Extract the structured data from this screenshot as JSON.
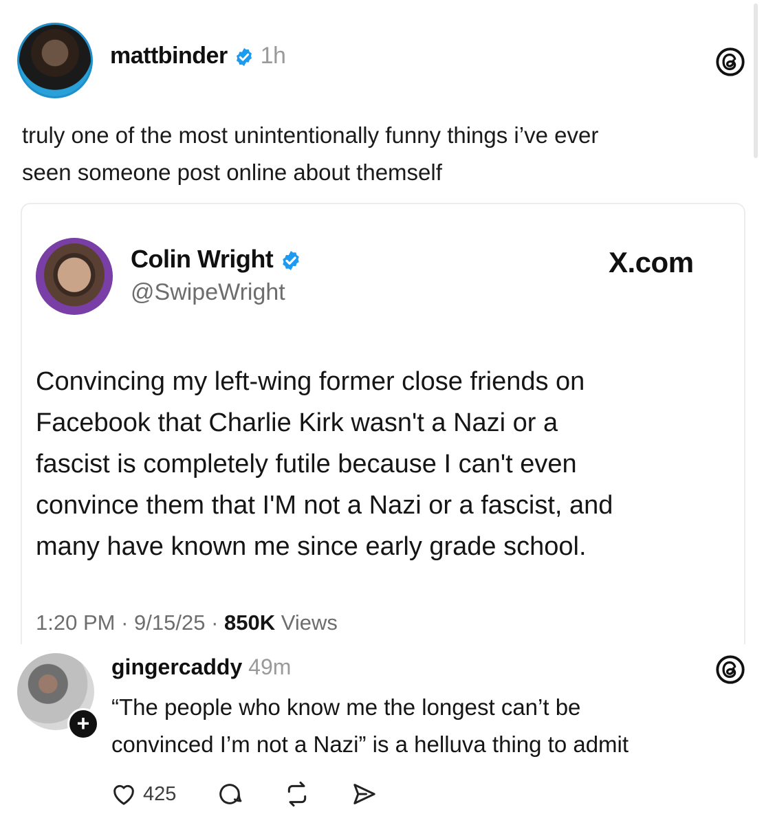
{
  "post": {
    "username": "mattbinder",
    "time": "1h",
    "text_line1": "truly one of the most unintentionally funny things i’ve ever",
    "text_line2": "seen someone post online about themself"
  },
  "quote": {
    "name": "Colin Wright",
    "handle": "@SwipeWright",
    "source": "X.com",
    "body_lines": [
      "Convincing my left-wing former close friends on",
      "Facebook that Charlie Kirk wasn't a Nazi or a",
      "fascist is completely futile because I can't even",
      "convince them that I'M not a Nazi or a fascist, and",
      "many have known me since early grade school."
    ],
    "meta_time": "1:20 PM",
    "meta_date": "9/15/25",
    "views_count": "850K",
    "views_label": "Views"
  },
  "reply": {
    "username": "gingercaddy",
    "time": "49m",
    "text_line1": "“The people who know me the longest can’t be",
    "text_line2": "convinced I’m not a Nazi” is a helluva thing to admit",
    "plus_badge": "+",
    "likes": "425"
  },
  "icons": {
    "verified": "verified-badge-icon",
    "threads": "threads-logo-icon",
    "like": "heart-icon",
    "reply": "comment-icon",
    "repost": "repost-icon",
    "share": "share-icon"
  },
  "colors": {
    "verified": "#1d9bf0",
    "muted": "#9a9a9a",
    "text": "#101010"
  }
}
